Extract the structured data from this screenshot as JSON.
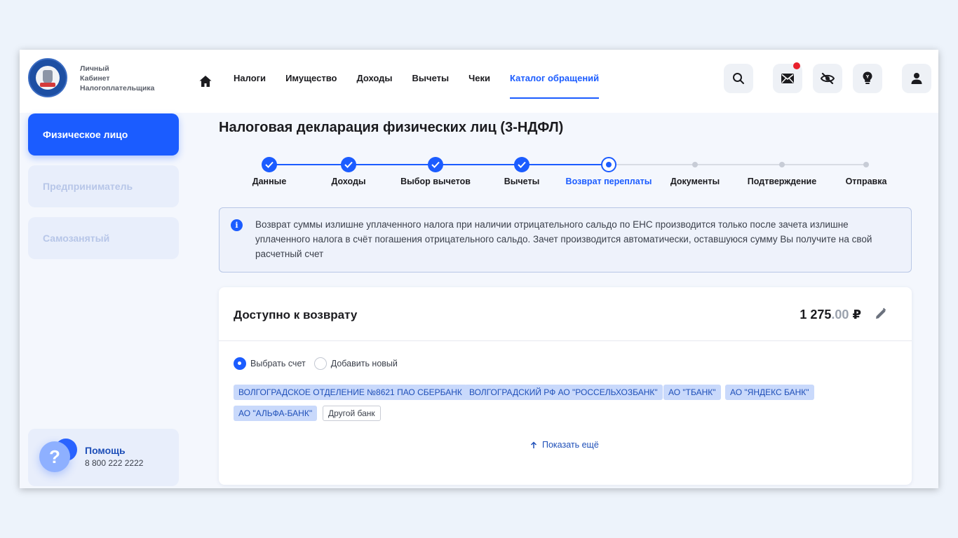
{
  "brand": {
    "line1": "Личный",
    "line2": "Кабинет",
    "line3": "Налогоплательщика"
  },
  "nav": {
    "items": [
      {
        "label": "Налоги"
      },
      {
        "label": "Имущество"
      },
      {
        "label": "Доходы"
      },
      {
        "label": "Вычеты"
      },
      {
        "label": "Чеки"
      },
      {
        "label": "Каталог обращений",
        "active": true
      }
    ]
  },
  "header_icons": [
    "search-icon",
    "mail-icon",
    "eye-off-icon",
    "lightbulb-icon",
    "user-icon"
  ],
  "sidebar": {
    "items": [
      {
        "label": "Физическое лицо",
        "active": true
      },
      {
        "label": "Предприниматель"
      },
      {
        "label": "Самозанятый"
      }
    ],
    "help_title": "Помощь",
    "help_phone": "8 800 222 2222"
  },
  "main": {
    "title": "Налоговая декларация физических лиц (3-НДФЛ)",
    "steps": [
      {
        "label": "Данные",
        "state": "done"
      },
      {
        "label": "Доходы",
        "state": "done"
      },
      {
        "label": "Выбор вычетов",
        "state": "done"
      },
      {
        "label": "Вычеты",
        "state": "done"
      },
      {
        "label": "Возврат переплаты",
        "state": "current"
      },
      {
        "label": "Документы",
        "state": "todo"
      },
      {
        "label": "Подтверждение",
        "state": "todo"
      },
      {
        "label": "Отправка",
        "state": "todo"
      }
    ],
    "info_text": "Возврат суммы излишне уплаченного налога при наличии отрицательного сальдо по ЕНС производится только после зачета излишне уплаченного налога в счёт погашения отрицательного сальдо. Зачет производится автоматически, оставшуюся сумму Вы получите на свой расчетный счет",
    "card": {
      "title": "Доступно к возврату",
      "amount_int": "1 275",
      "amount_dec": ".00",
      "currency": "₽",
      "radio_select": "Выбрать счет",
      "radio_add": "Добавить новый",
      "banks": [
        "ВОЛГОГРАДСКОЕ ОТДЕЛЕНИЕ №8621 ПАО СБЕРБАНК",
        "ВОЛГОГРАДСКИЙ РФ АО \"РОССЕЛЬХОЗБАНК\"",
        "АО \"ТБАНК\"",
        "АО \"ЯНДЕКС БАНК\"",
        "АО \"АЛЬФА-БАНК\""
      ],
      "other_bank": "Другой банк",
      "show_more": "Показать ещё"
    }
  },
  "colors": {
    "accent": "#1b5cff",
    "notification": "#e8202b"
  }
}
